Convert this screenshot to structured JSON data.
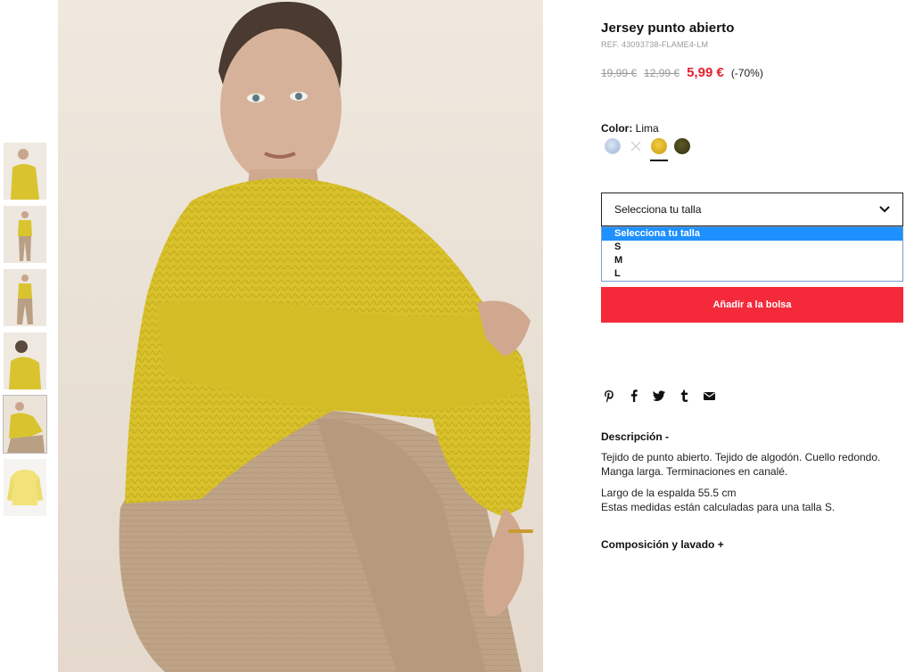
{
  "product": {
    "title": "Jersey punto abierto",
    "ref": "REF. 43093738-FLAME4-LM",
    "price_original": "19,99 €",
    "price_previous": "12,99 €",
    "price_sale": "5,99 €",
    "discount": "(-70%)"
  },
  "color": {
    "label": "Color:",
    "value": "Lima",
    "swatches": [
      "light-blue-pattern",
      "white-unavailable",
      "yellow-lima",
      "olive-green"
    ],
    "selected_index": 2
  },
  "size": {
    "placeholder": "Selecciona tu talla",
    "options": [
      "Selecciona tu talla",
      "S",
      "M",
      "L"
    ],
    "highlighted_index": 0
  },
  "actions": {
    "add_to_bag": "Añadir a la bolsa"
  },
  "social": [
    "pinterest-icon",
    "facebook-icon",
    "twitter-icon",
    "tumblr-icon",
    "email-icon"
  ],
  "description": {
    "heading": "Descripción -",
    "paragraph1_line1": "Tejido de punto abierto. Tejido de algodón. Cuello redondo.",
    "paragraph1_line2": "Manga larga. Terminaciones en canalé.",
    "paragraph2_line1": "Largo de la espalda 55.5 cm",
    "paragraph2_line2": "Estas medidas están calculadas para una talla S."
  },
  "composition": {
    "heading": "Composición y lavado +"
  },
  "colors": {
    "sale_red": "#e2232f",
    "button_red": "#f42a3a",
    "highlight_blue": "#1e90ff",
    "sweater_yellow": "#d9c22a"
  }
}
